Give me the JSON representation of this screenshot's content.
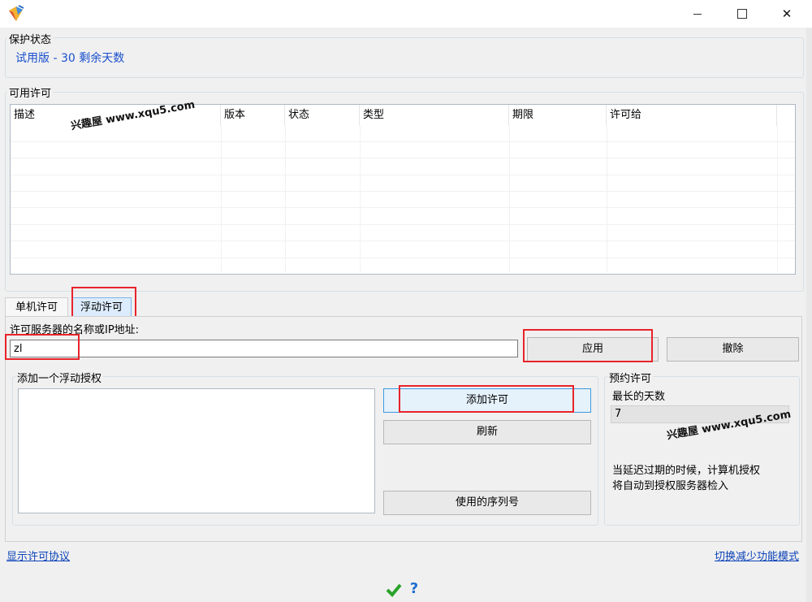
{
  "window": {
    "minimize_icon": "minimize-icon",
    "maximize_icon": "maximize-icon",
    "close_icon": "close-icon"
  },
  "protection": {
    "title": "保护状态",
    "status": "试用版 - 30 剩余天数",
    "status_color": "#1a4fce"
  },
  "available": {
    "title": "可用许可",
    "columns": [
      "描述",
      "版本",
      "状态",
      "类型",
      "期限",
      "许可给"
    ],
    "rows": []
  },
  "tabs": [
    {
      "label": "单机许可"
    },
    {
      "label": "浮动许可"
    }
  ],
  "floating": {
    "server_label": "许可服务器的名称或IP地址:",
    "server_value": "zl",
    "apply_label": "应用",
    "cancel_label": "撤除",
    "add_group_title": "添加一个浮动授权",
    "add_label": "添加许可",
    "refresh_label": "刷新",
    "serials_label": "使用的序列号"
  },
  "reserve": {
    "title": "预约许可",
    "max_days_label": "最长的天数",
    "max_days_value": "7",
    "note_line1": "当延迟过期的时候，计算机授权",
    "note_line2": "将自动到授权服务器检入"
  },
  "watermark": "兴趣屋 www.xqu5.com",
  "footer": {
    "show_agreement": "显示许可协议",
    "switch_mode": "切换减少功能模式",
    "ok_icon": "checkmark-icon",
    "help_icon": "question-icon"
  },
  "colors": {
    "highlight": "#e8232a",
    "link": "#0a41b8",
    "active_tab": "#dcecfc"
  }
}
